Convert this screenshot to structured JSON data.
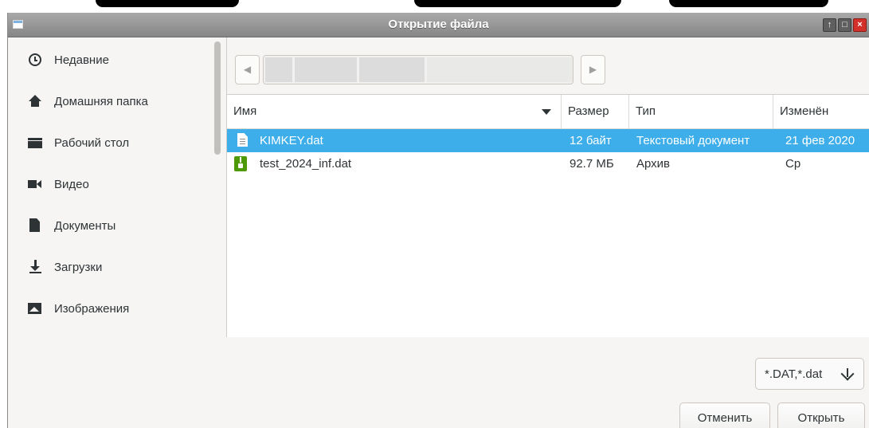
{
  "window": {
    "title": "Открытие файла"
  },
  "sidebar": {
    "items": [
      {
        "label": "Недавние",
        "icon": "clock-icon"
      },
      {
        "label": "Домашняя папка",
        "icon": "home-icon"
      },
      {
        "label": "Рабочий стол",
        "icon": "desktop-icon"
      },
      {
        "label": "Видео",
        "icon": "video-icon"
      },
      {
        "label": "Документы",
        "icon": "document-icon"
      },
      {
        "label": "Загрузки",
        "icon": "download-icon"
      },
      {
        "label": "Изображения",
        "icon": "image-icon"
      }
    ]
  },
  "columns": {
    "name": "Имя",
    "size": "Размер",
    "type": "Тип",
    "modified": "Изменён"
  },
  "files": [
    {
      "name": "KIMKEY.dat",
      "size": "12 байт",
      "type": "Текстовый документ",
      "modified": "21 фев 2020",
      "icon": "text-file-icon",
      "selected": true
    },
    {
      "name": "test_2024_inf.dat",
      "size": "92.7 МБ",
      "type": "Архив",
      "modified": "Ср",
      "icon": "archive-icon",
      "selected": false
    }
  ],
  "filter": {
    "value": "*.DAT,*.dat",
    "icon": "arrow-down-icon"
  },
  "buttons": {
    "cancel": "Отменить",
    "open": "Открыть"
  },
  "colors": {
    "selection": "#3daee9",
    "titlebar": "#8f8f8f",
    "close": "#d4302a",
    "archive": "#4e9a06"
  }
}
